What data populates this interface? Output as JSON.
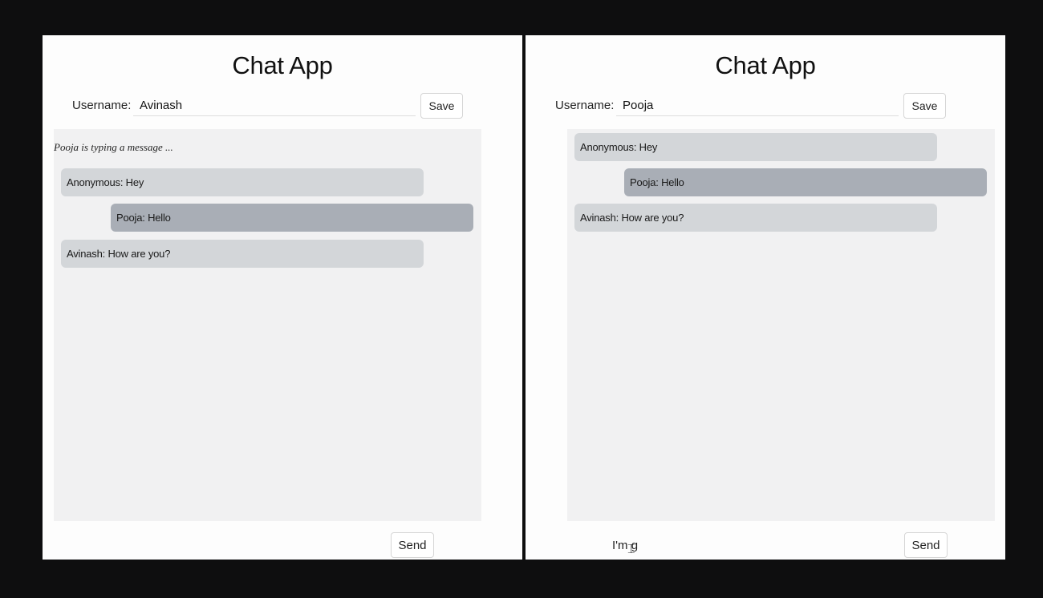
{
  "left_window": {
    "title": "Chat App",
    "username_label": "Username:",
    "username_value": "Avinash",
    "save_label": "Save",
    "typing_indicator": "Pooja is typing a message ...",
    "messages": [
      {
        "text": "Anonymous: Hey",
        "own": false
      },
      {
        "text": "Pooja: Hello",
        "own": false
      },
      {
        "text": "Avinash: How are you?",
        "own": false
      }
    ],
    "message_input_value": "",
    "send_label": "Send"
  },
  "right_window": {
    "title": "Chat App",
    "username_label": "Username:",
    "username_value": "Pooja",
    "save_label": "Save",
    "messages": [
      {
        "text": "Anonymous: Hey",
        "own": false
      },
      {
        "text": "Pooja: Hello",
        "own": true
      },
      {
        "text": "Avinash: How are you?",
        "own": false
      }
    ],
    "message_input_value": "I'm g",
    "send_label": "Send"
  },
  "icons": {
    "text_cursor": "i-beam-cursor-icon"
  },
  "colors": {
    "background": "#0e0e0f",
    "window": "#fdfdfd",
    "chat_area": "#f1f1f2",
    "bubble_other": "#d3d6d9",
    "bubble_own": "#a9aeb6"
  }
}
